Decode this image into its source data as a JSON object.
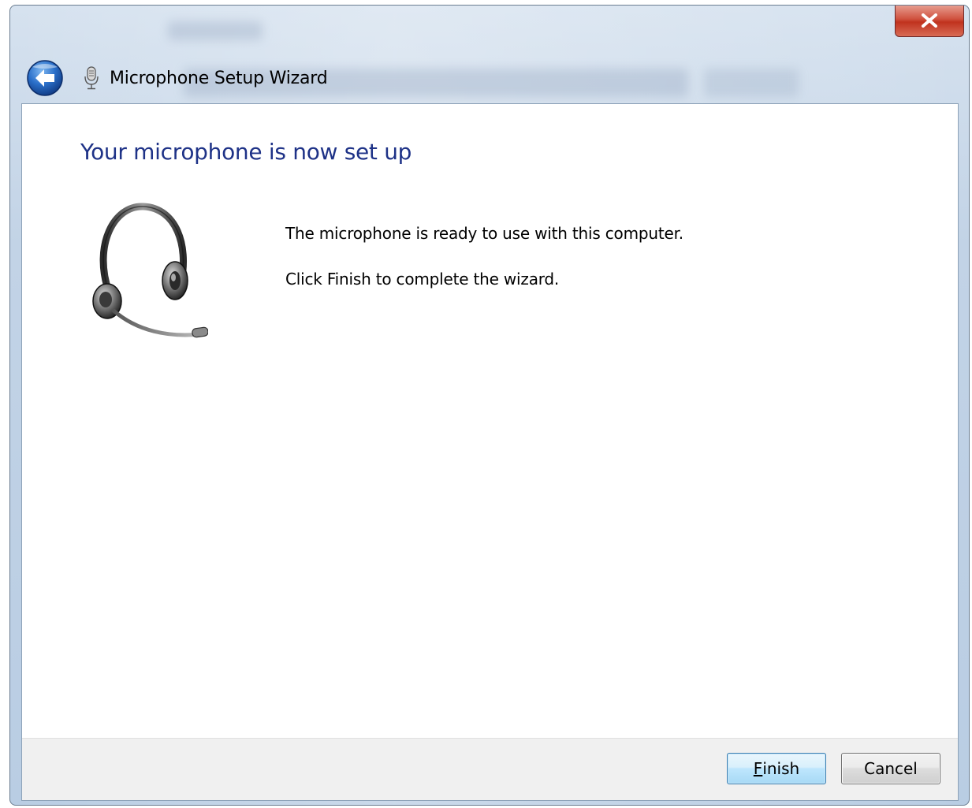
{
  "window": {
    "title": "Microphone Setup Wizard"
  },
  "icons": {
    "back": "back-arrow-icon",
    "close": "close-icon",
    "title": "microphone-icon",
    "illustration": "headset-icon"
  },
  "content": {
    "heading": "Your microphone is now set up",
    "line1": "The microphone is ready to use with this computer.",
    "line2": "Click Finish to complete the wizard."
  },
  "footer": {
    "finish_accesskey": "F",
    "finish_rest": "inish",
    "cancel_label": "Cancel"
  },
  "colors": {
    "heading": "#1e3287",
    "close_button": "#c0321e",
    "back_button": "#2a6fc9"
  }
}
